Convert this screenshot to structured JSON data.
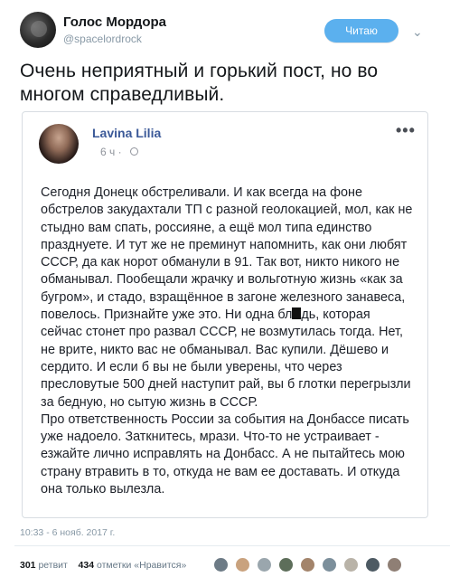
{
  "header": {
    "display_name": "Голос Мордора",
    "handle": "@spacelordrock",
    "follow_label": "Читаю",
    "chevron_glyph": "⌄"
  },
  "tweet": {
    "text": "Очень неприятный и горький пост, но во многом справедливый."
  },
  "embedded_post": {
    "author": "Lavina Lilia",
    "time": "6 ч ·",
    "more_glyph": "•••",
    "body_before_redaction": "Сегодня Донецк обстреливали. И как всегда на фоне обстрелов закудахтали ТП с разной геолокацией, мол, как не стыдно вам спать, россияне, а ещё мол типа единство празднуете. И тут же не преминут напомнить, как они любят СССР, да как норот обманули в 91. Так вот, никто никого не обманывал. Пообещали жрачку и вольготную жизнь «как за бугром», и стадо, взращённое в загоне железного занавеса, повелось. Признайте уже это. Ни одна бл",
    "body_after_redaction": "дь, которая сейчас стонет про развал СССР, не возмутилась тогда. Нет, не врите, никто вас не обманывал. Вас купили. Дёшево и сердито. И если б вы не были уверены, что через пресловутые 500 дней наступит рай, вы б глотки перегрызли за бедную, но сытую жизнь в СССР.",
    "body_paragraph_2": "Про ответственность России за события на Донбассе писать уже надоело. Заткнитесь, мрази. Что-то не устраивает - езжайте лично исправлять на Донбасс. А не пытайтесь мою страну втравить в то, откуда не вам ее доставать. И откуда она только вылезла."
  },
  "footer": {
    "timestamp": "10:33 - 6 нояб. 2017 г.",
    "retweets_count": "301",
    "retweets_label": "ретвит",
    "likes_count": "434",
    "likes_label": "отметки «Нравится»"
  },
  "colors": {
    "follow_button": "#5bb0ee",
    "author_link": "#3b5998",
    "muted": "#8899a6"
  }
}
